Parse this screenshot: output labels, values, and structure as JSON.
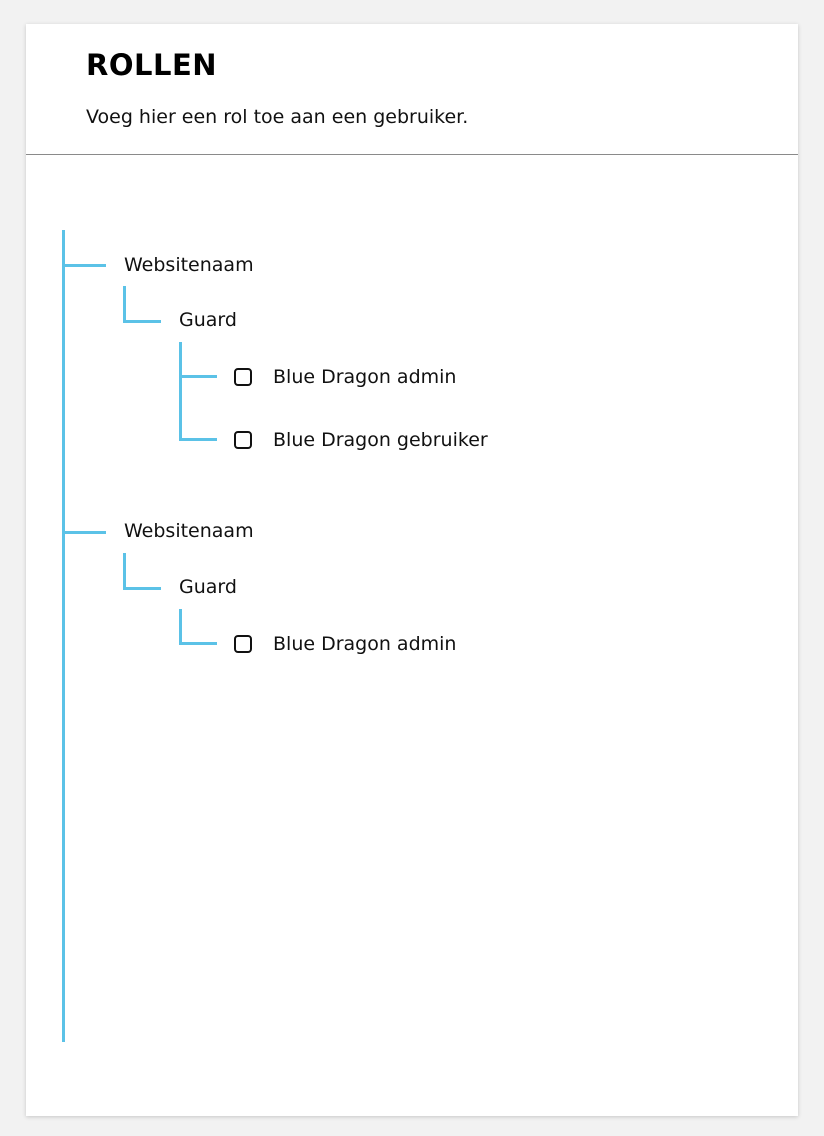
{
  "header": {
    "title": "ROLLEN",
    "subtitle": "Voeg hier een rol toe aan een gebruiker."
  },
  "colors": {
    "tree_line": "#5bc2e7",
    "background": "#f2f2f2",
    "card": "#ffffff"
  },
  "tree": {
    "websites": [
      {
        "label": "Websitenaam",
        "guards": [
          {
            "label": "Guard",
            "roles": [
              {
                "label": "Blue Dragon admin",
                "checked": false
              },
              {
                "label": "Blue Dragon gebruiker",
                "checked": false
              }
            ]
          }
        ]
      },
      {
        "label": "Websitenaam",
        "guards": [
          {
            "label": "Guard",
            "roles": [
              {
                "label": "Blue Dragon admin",
                "checked": false
              }
            ]
          }
        ]
      }
    ]
  }
}
